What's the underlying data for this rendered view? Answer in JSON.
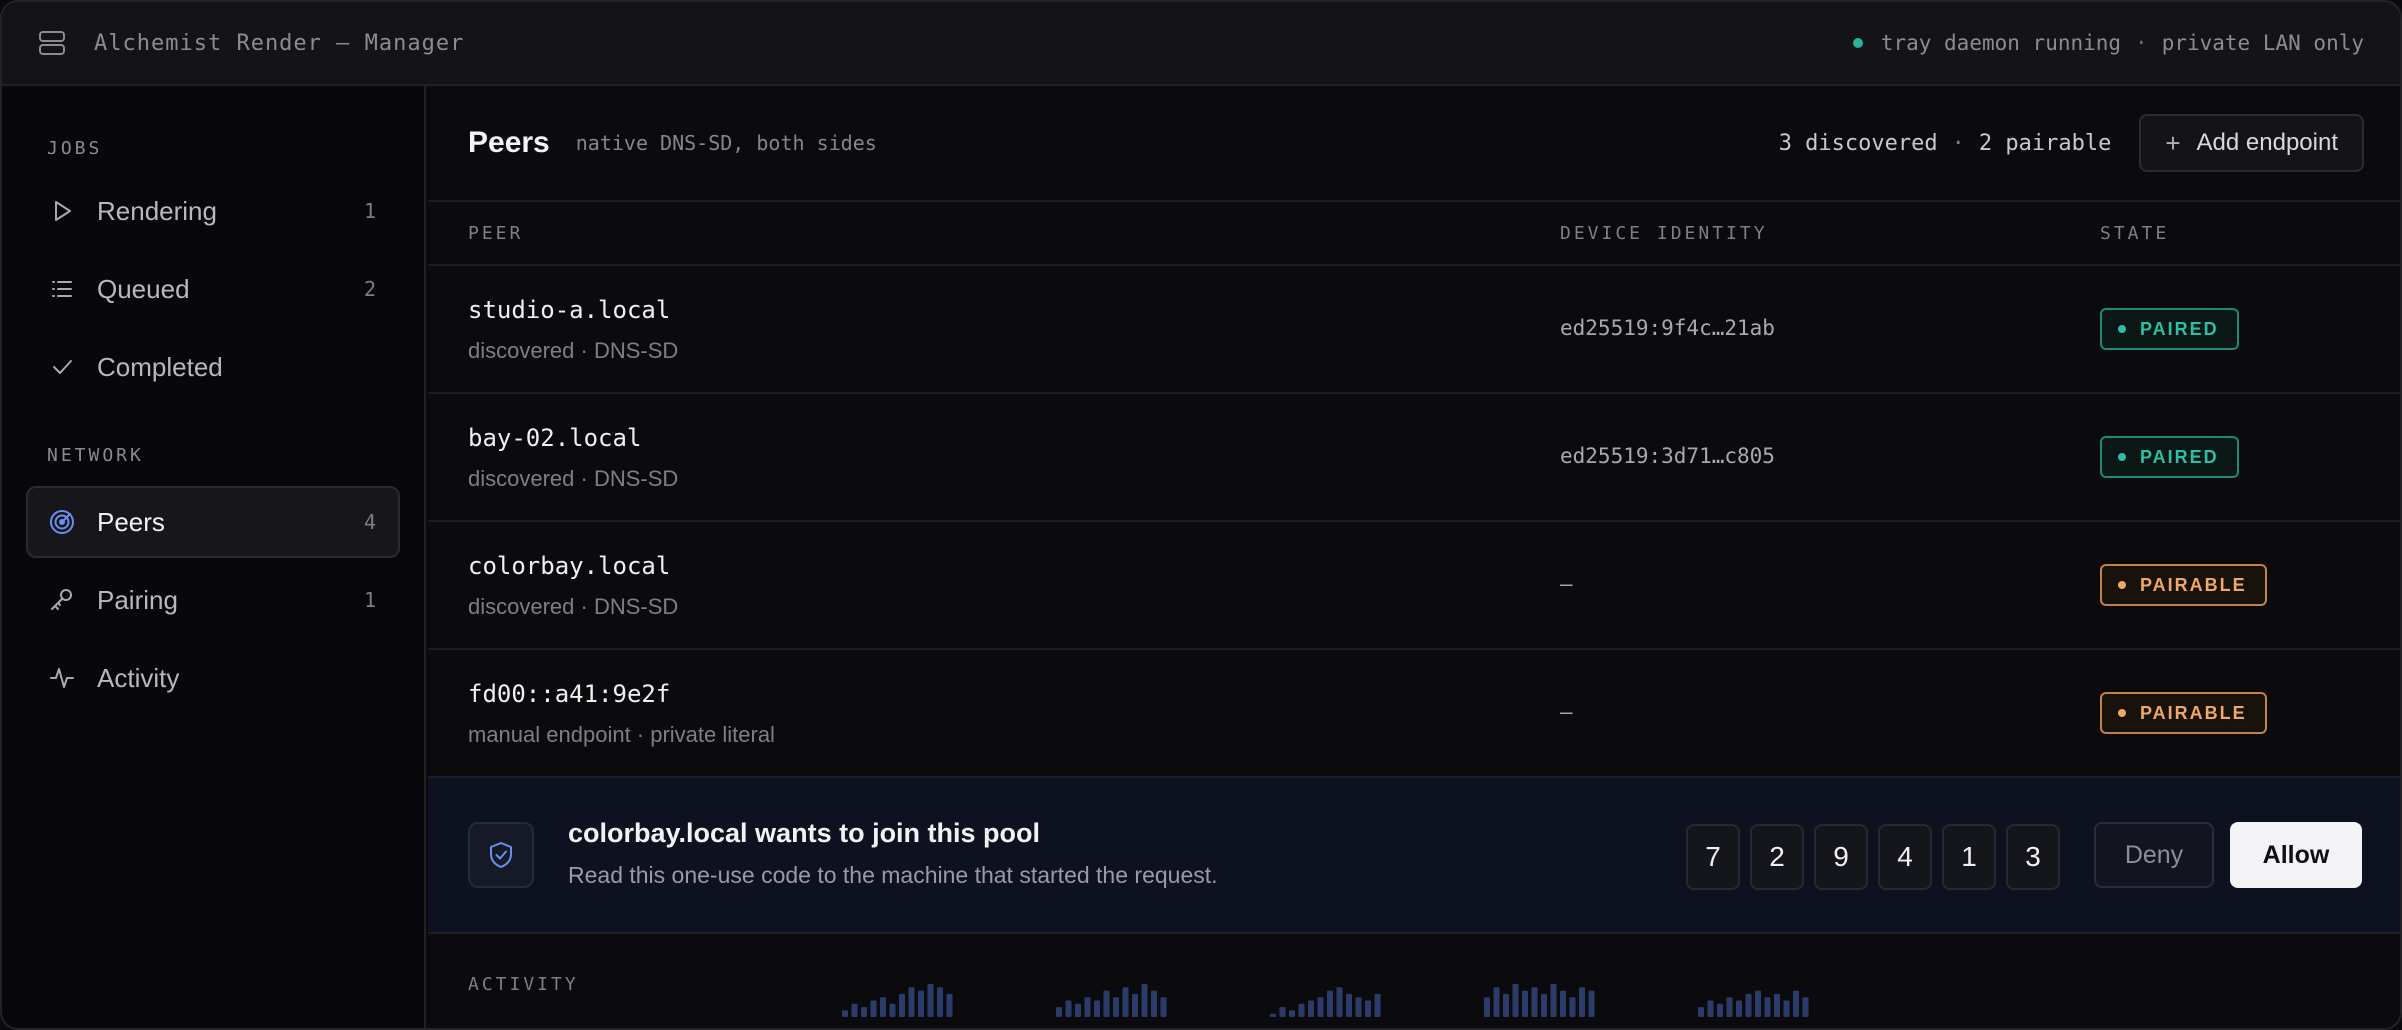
{
  "window": {
    "title": "Alchemist Render — Manager",
    "status_text": "tray daemon running",
    "status_sep": "·",
    "status_scope": "private LAN only"
  },
  "sidebar": {
    "jobs_label": "JOBS",
    "network_label": "NETWORK",
    "jobs": [
      {
        "label": "Rendering",
        "count": "1",
        "icon": "play-icon"
      },
      {
        "label": "Queued",
        "count": "2",
        "icon": "list-icon"
      },
      {
        "label": "Completed",
        "count": "",
        "icon": "check-icon"
      }
    ],
    "network": [
      {
        "label": "Peers",
        "count": "4",
        "icon": "radar-icon",
        "active": true
      },
      {
        "label": "Pairing",
        "count": "1",
        "icon": "key-icon"
      },
      {
        "label": "Activity",
        "count": "",
        "icon": "pulse-icon"
      }
    ]
  },
  "header": {
    "title": "Peers",
    "subtitle": "native DNS-SD, both sides",
    "discovered": "3 discovered",
    "sep": "·",
    "pairable": "2 pairable",
    "add_button": "Add endpoint"
  },
  "table": {
    "columns": {
      "peer": "PEER",
      "identity": "DEVICE IDENTITY",
      "state": "STATE"
    },
    "rows": [
      {
        "name": "studio-a.local",
        "sub": "discovered · DNS-SD",
        "identity": "ed25519:9f4c…21ab",
        "state": "PAIRED"
      },
      {
        "name": "bay-02.local",
        "sub": "discovered · DNS-SD",
        "identity": "ed25519:3d71…c805",
        "state": "PAIRED"
      },
      {
        "name": "colorbay.local",
        "sub": "discovered · DNS-SD",
        "identity": "—",
        "state": "PAIRABLE"
      },
      {
        "name": "fd00::a41:9e2f",
        "sub": "manual endpoint · private literal",
        "identity": "—",
        "state": "PAIRABLE"
      }
    ]
  },
  "request": {
    "title": "colorbay.local wants to join this pool",
    "subtitle": "Read this one-use code to the machine that started the request.",
    "code": [
      "7",
      "2",
      "9",
      "4",
      "1",
      "3"
    ],
    "deny_label": "Deny",
    "allow_label": "Allow"
  },
  "activity": {
    "label": "ACTIVITY",
    "groups": [
      [
        2,
        4,
        3,
        5,
        6,
        4,
        7,
        9,
        8,
        10,
        9,
        7
      ],
      [
        3,
        5,
        4,
        6,
        5,
        8,
        6,
        9,
        7,
        10,
        8,
        6
      ],
      [
        1,
        3,
        2,
        4,
        5,
        6,
        8,
        9,
        7,
        6,
        5,
        7
      ],
      [
        6,
        9,
        7,
        10,
        8,
        9,
        7,
        10,
        8,
        6,
        9,
        8
      ],
      [
        3,
        5,
        4,
        6,
        5,
        7,
        8,
        6,
        7,
        5,
        8,
        6
      ]
    ]
  },
  "colors": {
    "accent": "#5b7fe0",
    "paired": "#2bbfa3",
    "pairable": "#f0a866",
    "activity_bar": "#2c3c6a"
  }
}
